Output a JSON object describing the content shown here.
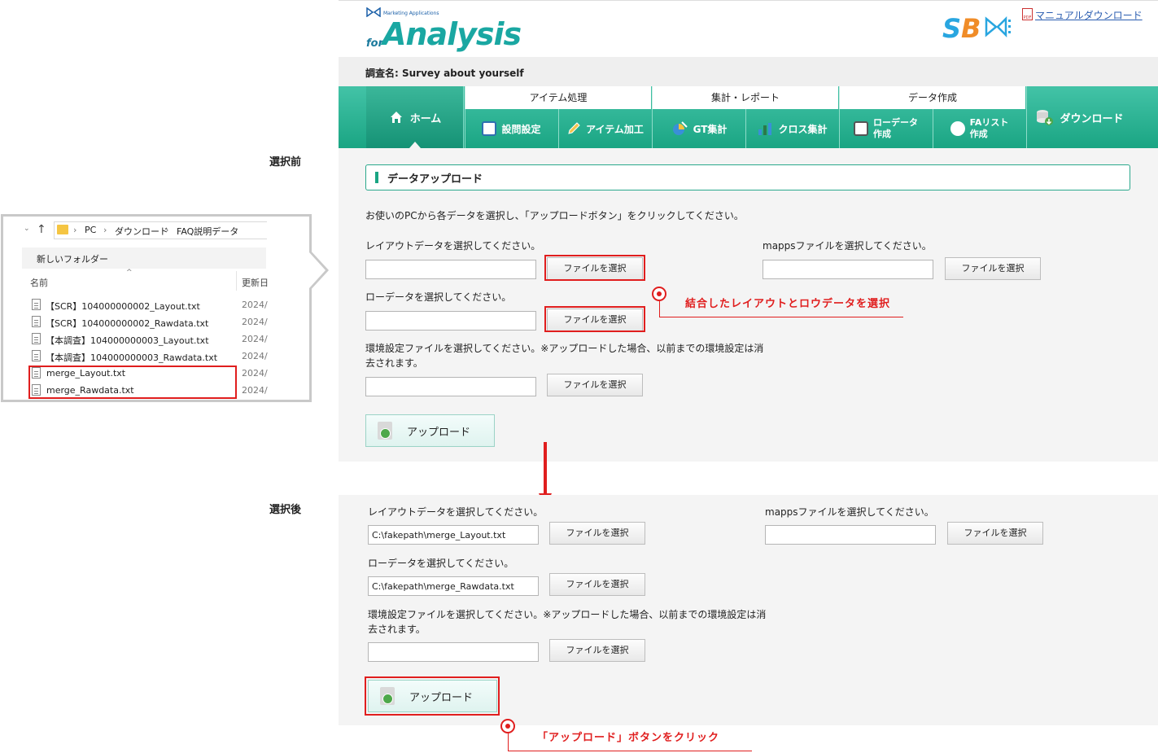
{
  "side_labels": {
    "before": "選択前",
    "after": "選択後"
  },
  "header": {
    "logo_small": "Marketing Applications",
    "logo_for": "for",
    "logo_main": "Analysis",
    "brand_s": "S",
    "brand_b": "B",
    "manual_link": "マニュアルダウンロード",
    "pdf_badge": "PDF"
  },
  "survey": {
    "label": "調査名:",
    "name": "Survey about yourself"
  },
  "nav": {
    "home": "ホーム",
    "groups": [
      {
        "label": "アイテム処理",
        "items": [
          "設問設定",
          "アイテム加工"
        ]
      },
      {
        "label": "集計・レポート",
        "items": [
          "GT集計",
          "クロス集計"
        ]
      },
      {
        "label": "データ作成",
        "items": [
          "ローデータ\n作成",
          "FAリスト\n作成"
        ]
      }
    ],
    "download": "ダウンロード"
  },
  "upload_section": {
    "title": "データアップロード",
    "instruction": "お使いのPCから各データを選択し、「アップロードボタン」をクリックしてください。",
    "layout_label": "レイアウトデータを選択してください。",
    "mapps_label": "mappsファイルを選択してください。",
    "raw_label": "ローデータを選択してください。",
    "env_label_line1": "環境設定ファイルを選択してください。※アップロードした場合、以前までの環境設定は消",
    "env_label_line2": "去されます。",
    "choose_file": "ファイルを選択",
    "upload_button": "アップロード"
  },
  "after_values": {
    "layout_value": "C:\\fakepath\\merge_Layout.txt",
    "raw_value": "C:\\fakepath\\merge_Rawdata.txt"
  },
  "notes": {
    "select_note": "結合したレイアウトとロウデータを選択",
    "click_note": "「アップロード」ボタンをクリック"
  },
  "explorer": {
    "path": [
      "PC",
      "ダウンロード",
      "FAQ説明データ"
    ],
    "new_folder": "新しいフォルダー",
    "col_name": "名前",
    "col_date": "更新日",
    "files": [
      {
        "name": "【SCR】104000000002_Layout.txt",
        "date": "2024/"
      },
      {
        "name": "【SCR】104000000002_Rawdata.txt",
        "date": "2024/"
      },
      {
        "name": "【本調査】104000000003_Layout.txt",
        "date": "2024/"
      },
      {
        "name": "【本調査】104000000003_Rawdata.txt",
        "date": "2024/"
      },
      {
        "name": "merge_Layout.txt",
        "date": "2024/"
      },
      {
        "name": "merge_Rawdata.txt",
        "date": "2024/"
      }
    ]
  },
  "colors": {
    "accent": "#1aa583",
    "highlight": "#e01e1e",
    "brand_blue": "#29a6e0",
    "brand_orange": "#f08c28"
  }
}
